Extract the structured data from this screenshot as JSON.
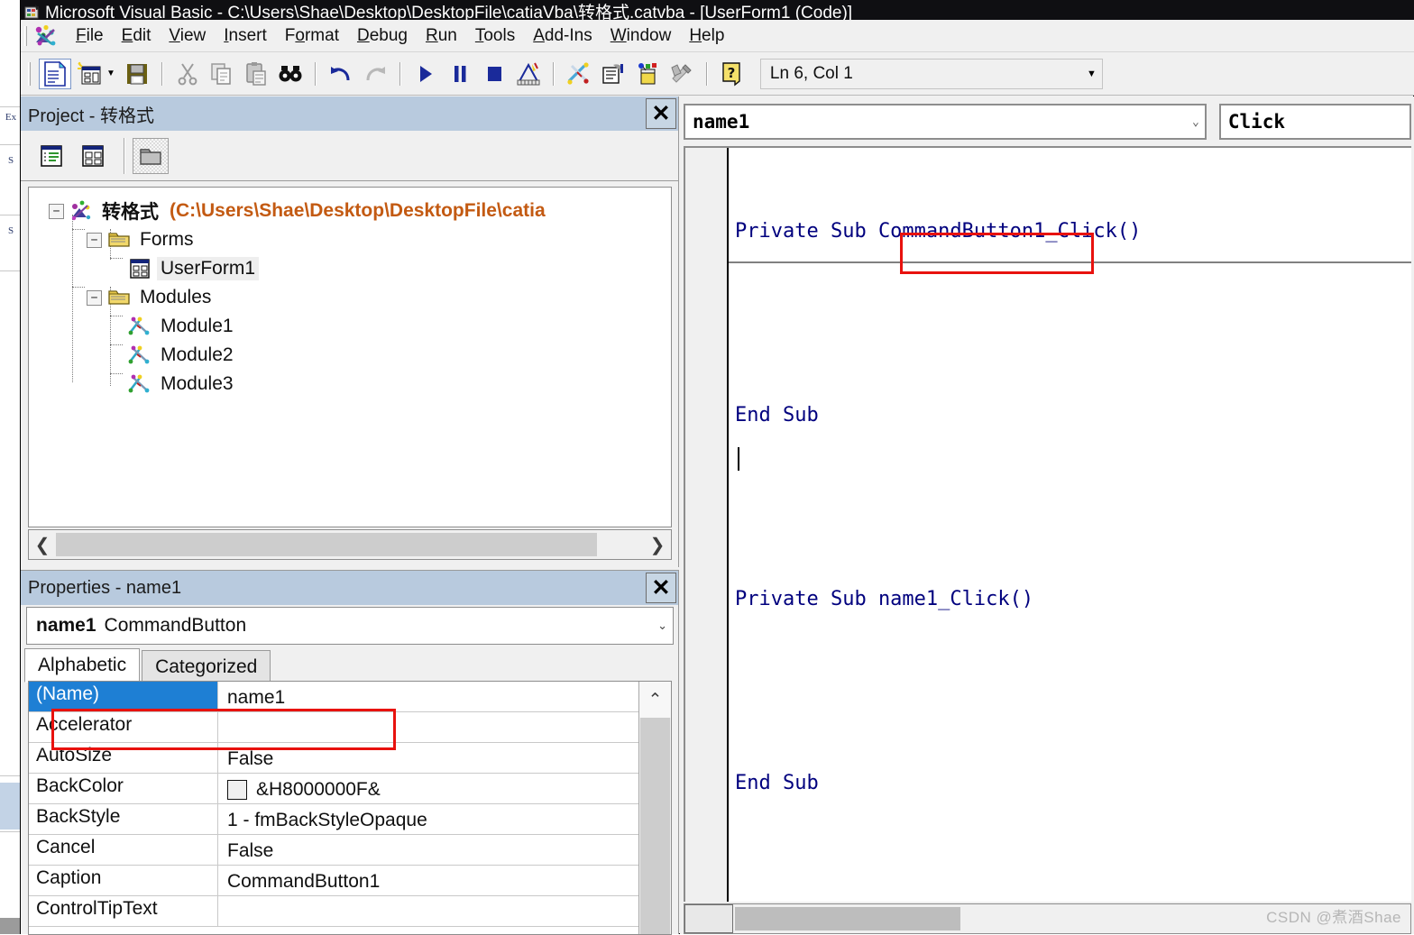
{
  "window": {
    "title": "Microsoft Visual Basic - C:\\Users\\Shae\\Desktop\\DesktopFile\\catiaVba\\转格式.catvba - [UserForm1 (Code)]",
    "app_icon": "visual-basic-icon"
  },
  "menubar": {
    "items": [
      {
        "label": "File",
        "accel": "F"
      },
      {
        "label": "Edit",
        "accel": "E"
      },
      {
        "label": "View",
        "accel": "V"
      },
      {
        "label": "Insert",
        "accel": "I"
      },
      {
        "label": "Format",
        "accel": "o"
      },
      {
        "label": "Debug",
        "accel": "D"
      },
      {
        "label": "Run",
        "accel": "R"
      },
      {
        "label": "Tools",
        "accel": "T"
      },
      {
        "label": "Add-Ins",
        "accel": "A"
      },
      {
        "label": "Window",
        "accel": "W"
      },
      {
        "label": "Help",
        "accel": "H"
      }
    ]
  },
  "toolbar": {
    "buttons": [
      {
        "name": "view-object-icon",
        "tip": "View Object"
      },
      {
        "name": "insert-userform-icon",
        "tip": "Insert UserForm"
      },
      {
        "name": "save-icon",
        "tip": "Save"
      },
      {
        "name": "cut-icon",
        "tip": "Cut"
      },
      {
        "name": "copy-icon",
        "tip": "Copy"
      },
      {
        "name": "paste-icon",
        "tip": "Paste"
      },
      {
        "name": "find-icon",
        "tip": "Find"
      },
      {
        "name": "undo-icon",
        "tip": "Undo"
      },
      {
        "name": "redo-icon",
        "tip": "Redo"
      },
      {
        "name": "run-icon",
        "tip": "Run Sub/UserForm"
      },
      {
        "name": "pause-icon",
        "tip": "Break"
      },
      {
        "name": "stop-icon",
        "tip": "Reset"
      },
      {
        "name": "design-mode-icon",
        "tip": "Design Mode"
      },
      {
        "name": "project-explorer-icon",
        "tip": "Project Explorer"
      },
      {
        "name": "properties-window-icon",
        "tip": "Properties Window"
      },
      {
        "name": "object-browser-icon",
        "tip": "Object Browser"
      },
      {
        "name": "toolbox-icon",
        "tip": "Toolbox"
      },
      {
        "name": "help-icon",
        "tip": "Help"
      }
    ],
    "status": "Ln 6, Col 1",
    "status_dropdown_arrow": "▼"
  },
  "project_panel": {
    "caption": "Project - 转格式",
    "close_label": "✕",
    "toolbar_buttons": [
      {
        "name": "view-code-icon",
        "label": "View Code"
      },
      {
        "name": "view-object-icon",
        "label": "View Object"
      },
      {
        "name": "toggle-folders-icon",
        "label": "Toggle Folders"
      }
    ],
    "tree": [
      {
        "level": 0,
        "expander": "−",
        "icon": "project-icon",
        "label": "转格式",
        "path": "(C:\\Users\\Shae\\Desktop\\DesktopFile\\catia",
        "bold": true
      },
      {
        "level": 1,
        "expander": "−",
        "icon": "folder-icon",
        "label": "Forms",
        "path": "",
        "bold": false
      },
      {
        "level": 2,
        "expander": "",
        "icon": "userform-icon",
        "label": "UserForm1",
        "path": "",
        "bold": false,
        "selected": true
      },
      {
        "level": 1,
        "expander": "−",
        "icon": "folder-icon",
        "label": "Modules",
        "path": "",
        "bold": false
      },
      {
        "level": 2,
        "expander": "",
        "icon": "module-icon",
        "label": "Module1",
        "path": "",
        "bold": false
      },
      {
        "level": 2,
        "expander": "",
        "icon": "module-icon",
        "label": "Module2",
        "path": "",
        "bold": false
      },
      {
        "level": 2,
        "expander": "",
        "icon": "module-icon",
        "label": "Module3",
        "path": "",
        "bold": false
      }
    ],
    "hscroll": {
      "left_arrow": "❮",
      "right_arrow": "❯"
    }
  },
  "properties_panel": {
    "caption": "Properties - name1",
    "close_label": "✕",
    "object_combo": {
      "name": "name1",
      "type": "CommandButton",
      "arrow": "⌄"
    },
    "tabs": [
      {
        "label": "Alphabetic",
        "active": true
      },
      {
        "label": "Categorized",
        "active": false
      }
    ],
    "rows": [
      {
        "key": "(Name)",
        "value": "name1",
        "selected": true,
        "swatch": null
      },
      {
        "key": "Accelerator",
        "value": "",
        "selected": false,
        "swatch": null
      },
      {
        "key": "AutoSize",
        "value": "False",
        "selected": false,
        "swatch": null
      },
      {
        "key": "BackColor",
        "value": "&H8000000F&",
        "selected": false,
        "swatch": "#f0f0f0"
      },
      {
        "key": "BackStyle",
        "value": "1 - fmBackStyleOpaque",
        "selected": false,
        "swatch": null
      },
      {
        "key": "Cancel",
        "value": "False",
        "selected": false,
        "swatch": null
      },
      {
        "key": "Caption",
        "value": "CommandButton1",
        "selected": false,
        "swatch": null
      },
      {
        "key": "ControlTipText",
        "value": "",
        "selected": false,
        "swatch": null
      }
    ],
    "vscroll": {
      "up_arrow": "⌃"
    }
  },
  "code_window": {
    "object_dropdown": {
      "value": "name1",
      "arrow": "⌄"
    },
    "procedure_dropdown": {
      "value": "Click",
      "arrow": ""
    },
    "lines": [
      "Private Sub CommandButton1_Click()",
      "",
      "End Sub",
      "",
      "Private Sub name1_Click()",
      "",
      "End Sub"
    ],
    "hscroll": {}
  },
  "annotations": [
    {
      "name": "annotation-code-procname",
      "color": "#e8120e",
      "target": "name1_Click()"
    },
    {
      "name": "annotation-property-name",
      "color": "#e8120e",
      "target": "(Name) name1"
    }
  ],
  "background_window": {
    "labels": [
      "Ex",
      "S",
      "S"
    ]
  },
  "watermark": "CSDN @煮酒Shae",
  "colors": {
    "titlebar": "#0f0f12",
    "panel_caption": "#b8cade",
    "chrome": "#f0f0f0",
    "code_text": "#00007e",
    "tree_path": "#c35a12",
    "selection": "#1e7fd4",
    "annotation": "#e8120e"
  }
}
